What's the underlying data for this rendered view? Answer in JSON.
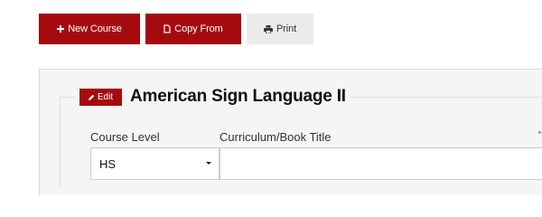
{
  "toolbar": {
    "new_course_label": "New Course",
    "copy_from_label": "Copy From",
    "print_label": "Print"
  },
  "icons": {
    "new_course": "plus-icon",
    "copy_from": "copy-icon",
    "print": "print-icon",
    "edit": "pencil-icon",
    "dropdown": "caret-down-icon"
  },
  "course": {
    "edit_label": "Edit",
    "title": "American Sign Language II"
  },
  "form": {
    "course_level_label": "Course Level",
    "course_level_value": "HS",
    "curriculum_label": "Curriculum/Book Title",
    "curriculum_value": ""
  },
  "colors": {
    "primary_red": "#a50b0e",
    "secondary_gray": "#ebebeb",
    "panel_bg": "#f5f5f5"
  }
}
